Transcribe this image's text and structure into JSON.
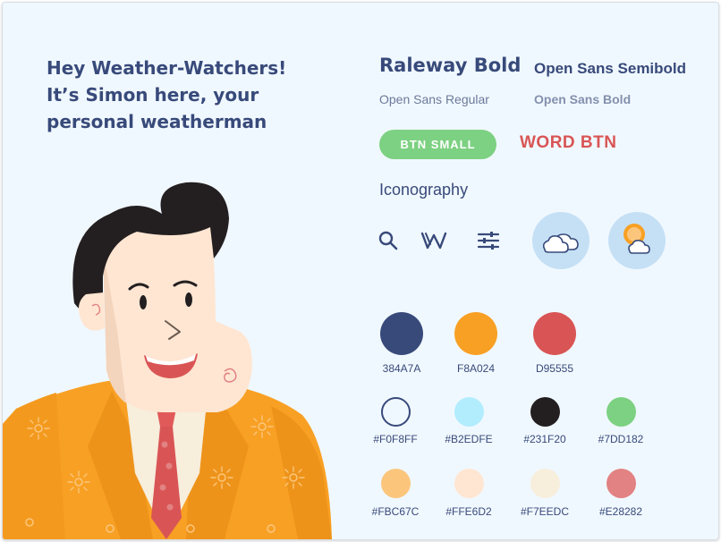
{
  "headline": {
    "line1": "Hey Weather-Watchers!",
    "line2": "It’s Simon here, your",
    "line3": "personal weatherman"
  },
  "typography": {
    "raleway_bold": "Raleway Bold",
    "open_sans_semibold": "Open Sans Semibold",
    "open_sans_regular": "Open Sans Regular",
    "open_sans_bold": "Open Sans Bold"
  },
  "buttons": {
    "small_label": "BTN SMALL",
    "word_label": "WORD BTN"
  },
  "iconography": {
    "title": "Iconography",
    "icons": [
      "search-icon",
      "w-logo-icon",
      "sliders-icon",
      "cloudy-icon",
      "partly-sunny-icon"
    ]
  },
  "palette": {
    "large": [
      {
        "label": "384A7A",
        "color": "#384A7A"
      },
      {
        "label": "F8A024",
        "color": "#F8A024"
      },
      {
        "label": "D95555",
        "color": "#D95555"
      }
    ],
    "row2": [
      {
        "label": "#F0F8FF",
        "color": "#F0F8FF"
      },
      {
        "label": "#B2EDFE",
        "color": "#B2EDFE"
      },
      {
        "label": "#231F20",
        "color": "#231F20"
      },
      {
        "label": "#7DD182",
        "color": "#7DD182"
      }
    ],
    "row3": [
      {
        "label": "#FBC67C",
        "color": "#FBC67C"
      },
      {
        "label": "#FFE6D2",
        "color": "#FFE6D2"
      },
      {
        "label": "#F7EEDC",
        "color": "#F7EEDC"
      },
      {
        "label": "#E28282",
        "color": "#E28282"
      }
    ]
  }
}
